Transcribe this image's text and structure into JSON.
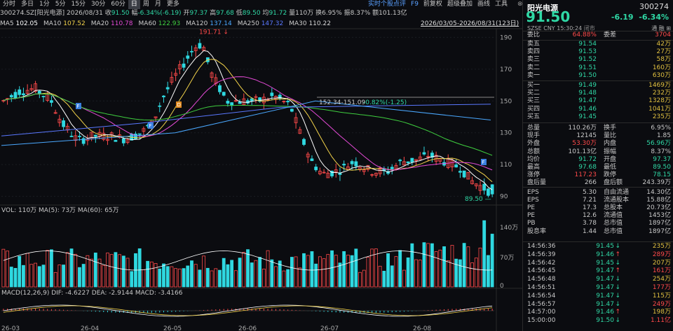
{
  "tabs": [
    "分时",
    "多日",
    "1分",
    "5分",
    "15分",
    "30分",
    "60分",
    "日",
    "周",
    "月",
    "更多"
  ],
  "active_tab": "日",
  "right_links": [
    "实时个股点评",
    "F9",
    "前复权",
    "超级叠加",
    "画线",
    "工具"
  ],
  "close_label": "⊗",
  "info": {
    "code": "300274.SZ[阳光电源]",
    "date": "2026/08/31",
    "close_label": "收",
    "close": "91.50",
    "amp_label": "幅",
    "chg": "-6.34%(-6.19)",
    "open_label": "开",
    "open": "97.37",
    "high_label": "高",
    "high": "97.68",
    "low_label": "低",
    "low": "89.50",
    "avg_label": "均",
    "avg": "91.72",
    "vol_label": "量",
    "vol": "110万",
    "turn_label": "换",
    "turn": "6.95%",
    "zhen_label": "振",
    "zhen": "8.37%",
    "amt_label": "额",
    "amt": "101.13亿"
  },
  "ma": [
    {
      "label": "MA5",
      "value": "102.05",
      "color": "#ffffff"
    },
    {
      "label": "MA10",
      "value": "107.52",
      "color": "#f2d24a"
    },
    {
      "label": "MA20",
      "value": "110.78",
      "color": "#e44ad6"
    },
    {
      "label": "MA60",
      "value": "122.93",
      "color": "#3fcf3f"
    },
    {
      "label": "MA120",
      "value": "137.14",
      "color": "#4aa8ff"
    },
    {
      "label": "MA250",
      "value": "147.32",
      "color": "#5a78ff"
    },
    {
      "label": "MA30",
      "value": "110.22",
      "color": "#d8d8d8"
    }
  ],
  "range": "2026/03/05-2026/08/31(123日)",
  "axis_prices": [
    "190",
    "170",
    "150",
    "130",
    "110",
    "90"
  ],
  "annot": {
    "high": "191.71",
    "low": "89.50",
    "segment": "152.34-151.09",
    "seg_chg": "-0.82%(-1.25)"
  },
  "vol_label": "VOL: 110万 MA(5): 73万 MA(60): 65万",
  "vol_axis": [
    "140万",
    "70万",
    "0"
  ],
  "macd_label": "MACD(12,26,9) DIF: -4.6227 DEA: -2.9144 MACD: -3.4166",
  "x_labels": [
    "26-03",
    "26-04",
    "26-05",
    "26-06",
    "26-07",
    "26-08"
  ],
  "side": {
    "name": "阳光电源",
    "code": "300274",
    "price": "91.50",
    "chg": "-6.19",
    "pct": "-6.34%",
    "sub_left": "SZSE CNY 15:30:24",
    "sub_mid": "闭市",
    "sub_right": "通 融 ⊞",
    "weibi": {
      "l": "委比",
      "v": "64.88%",
      "l2": "委差",
      "v2": "3704"
    },
    "asks": [
      [
        "卖五",
        "91.54",
        "42万"
      ],
      [
        "卖四",
        "91.53",
        "27万"
      ],
      [
        "卖三",
        "91.52",
        "58万"
      ],
      [
        "卖二",
        "91.51",
        "160万"
      ],
      [
        "卖一",
        "91.50",
        "630万"
      ]
    ],
    "bids": [
      [
        "买一",
        "91.49",
        "1469万"
      ],
      [
        "买二",
        "91.48",
        "232万"
      ],
      [
        "买三",
        "91.47",
        "1328万"
      ],
      [
        "买四",
        "91.46",
        "1041万"
      ],
      [
        "买五",
        "91.45",
        "235万"
      ]
    ],
    "stats": [
      [
        "总量",
        "110.26万",
        "换手",
        "6.95%"
      ],
      [
        "现手",
        "12145",
        "量比",
        "1.85"
      ],
      [
        "外盘",
        "53.30万",
        "内盘",
        "56.96万"
      ],
      [
        "总额",
        "101.13亿",
        "振幅",
        "8.37%"
      ],
      [
        "均价",
        "91.72",
        "开盘",
        "97.37"
      ],
      [
        "最高",
        "97.68",
        "最低",
        "89.50"
      ],
      [
        "涨停",
        "117.23",
        "跌停",
        "78.15"
      ],
      [
        "盘后量",
        "266",
        "盘后额",
        "243.39万"
      ],
      [
        "EPS",
        "5.30",
        "自由流通",
        "14.30亿"
      ],
      [
        "EPS",
        "7.21",
        "流通股本",
        "15.88亿"
      ],
      [
        "PE",
        "17.3",
        "总股本",
        "20.73亿"
      ],
      [
        "PE",
        "12.6",
        "流通值",
        "1453亿"
      ],
      [
        "PB",
        "3.78",
        "总市值",
        "1897亿"
      ],
      [
        "股息率",
        "1.44",
        "总市值",
        "1897亿"
      ]
    ],
    "ticks": [
      [
        "14:56:36",
        "91.45",
        "235万"
      ],
      [
        "14:56:39",
        "91.46",
        "289万"
      ],
      [
        "14:56:42",
        "91.45",
        "207万"
      ],
      [
        "14:56:45",
        "91.47",
        "161万"
      ],
      [
        "14:56:48",
        "91.47",
        "254万"
      ],
      [
        "14:56:51",
        "91.47",
        "177万"
      ],
      [
        "14:56:54",
        "91.47",
        "115万"
      ],
      [
        "14:56:57",
        "91.47",
        "249万"
      ],
      [
        "14:57:00",
        "91.46",
        "198万"
      ],
      [
        "15:00:00",
        "91.50",
        "1.11亿"
      ]
    ]
  }
}
